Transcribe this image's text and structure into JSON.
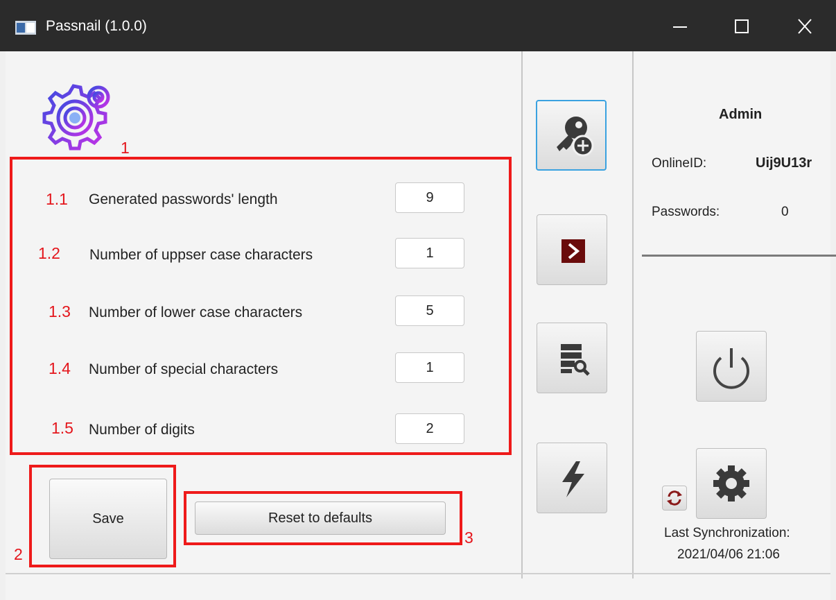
{
  "window": {
    "title": "Passnail (1.0.0)"
  },
  "settings": {
    "section_marker": "1",
    "fields": [
      {
        "marker": "1.1",
        "label": "Generated passwords' length",
        "value": "9"
      },
      {
        "marker": "1.2",
        "label": "Number of uppser case characters",
        "value": "1"
      },
      {
        "marker": "1.3",
        "label": "Number of lower case characters",
        "value": "5"
      },
      {
        "marker": "1.4",
        "label": "Number of special characters",
        "value": "1"
      },
      {
        "marker": "1.5",
        "label": "Number of digits",
        "value": "2"
      }
    ]
  },
  "actions": {
    "save_label": "Save",
    "save_marker": "2",
    "reset_label": "Reset to defaults",
    "reset_marker": "3"
  },
  "user": {
    "name": "Admin",
    "online_id_label": "OnlineID:",
    "online_id": "Uij9U13r",
    "passwords_label": "Passwords:",
    "passwords_count": "0"
  },
  "sync": {
    "label": "Last Synchronization:",
    "timestamp": "2021/04/06 21:06"
  },
  "colors": {
    "annotation": "#ee1a1a",
    "accent": "#3aa2e0",
    "titlebar": "#2b2b2b"
  }
}
